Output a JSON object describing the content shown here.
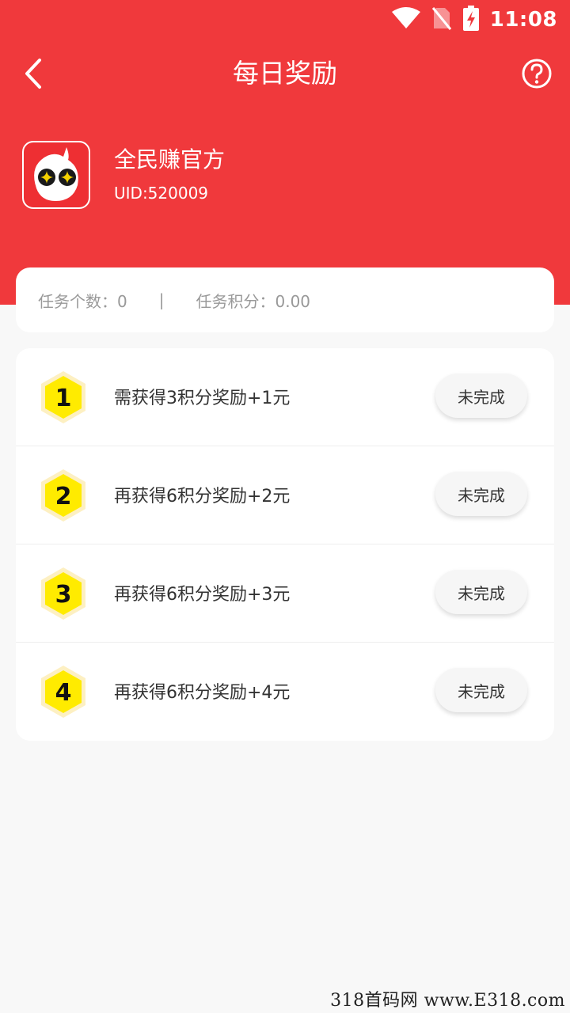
{
  "status_bar": {
    "time": "11:08",
    "icons": [
      "wifi-icon",
      "no-sim-icon",
      "battery-charging-icon"
    ]
  },
  "header": {
    "title": "每日奖励",
    "back_icon": "chevron-left-icon",
    "help_icon": "question-circle-icon"
  },
  "profile": {
    "name": "全民赚官方",
    "uid": "UID:520009"
  },
  "summary": {
    "task_count": "任务个数：0",
    "separator": "|",
    "task_points": "任务积分：0.00"
  },
  "tasks": [
    {
      "number": "1",
      "text": "需获得3积分奖励+1元",
      "status": "未完成"
    },
    {
      "number": "2",
      "text": "再获得6积分奖励+2元",
      "status": "未完成"
    },
    {
      "number": "3",
      "text": "再获得6积分奖励+3元",
      "status": "未完成"
    },
    {
      "number": "4",
      "text": "再获得6积分奖励+4元",
      "status": "未完成"
    }
  ],
  "watermark": "318首码网 www.E318.com",
  "colors": {
    "primary": "#f0393c",
    "background": "#f8f8f8",
    "badge_yellow": "#ffeb00",
    "badge_outline": "#fdf0c2"
  }
}
